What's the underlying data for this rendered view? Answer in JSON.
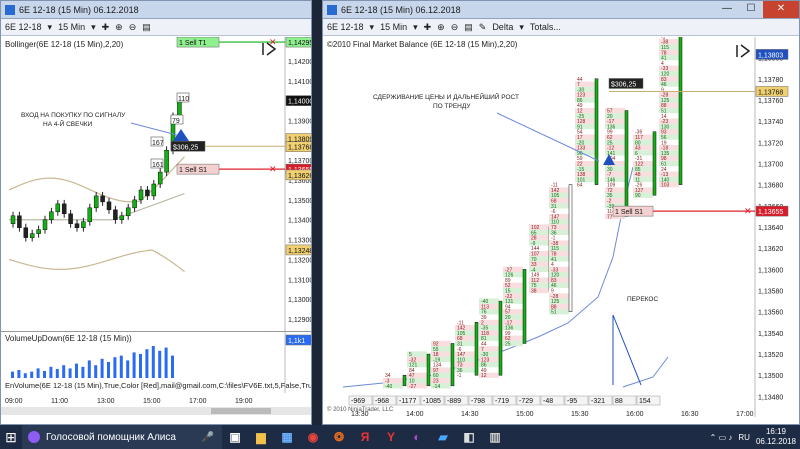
{
  "left": {
    "title": "6E 12-18 (15 Min)  06.12.2018",
    "toolbar": {
      "instrument": "6E 12-18",
      "interval": "15 Min"
    },
    "indicator": "Bollinger(6E 12-18 (15 Min),2,20)",
    "annotation": "ВХОД НА ПОКУПКУ ПО СИГНАЛУ\nНА 4-Й СВЕЧКИ",
    "orders": {
      "target": "1 Sell T1",
      "position": "$306,25",
      "stop": "1 Sell S1"
    },
    "price_levels": [
      "1,14200",
      "1,14100",
      "1,14000",
      "1,13900",
      "1,13800",
      "1,13700",
      "1,13600",
      "1,13500",
      "1,13400",
      "1,13300",
      "1,13200",
      "1,13100",
      "1,13000",
      "1,12900"
    ],
    "tags": {
      "t1": "1,14295",
      "px": "1,14000",
      "t2": "1,13809",
      "t3": "1,13768",
      "stop": "1,13655",
      "t4": "1,13626",
      "t5": "1,13248"
    },
    "volume_label": "VolumeUpDown(6E 12-18 (15 Min))",
    "volume_tag": "1,1k1",
    "volume_footer": "EnVolume(6E 12-18 (15 Min),True,Color [Red],mail@gmail.com,C:\\files\\FV6E.txt,5,False,True",
    "times": [
      "09:00",
      "11:00",
      "13:00",
      "15:00",
      "17:00",
      "19:00"
    ],
    "candle_labels": [
      "110",
      "79",
      "167",
      "161"
    ]
  },
  "right": {
    "title": "6E 12-18 (15 Min)  06.12.2018",
    "toolbar": {
      "instrument": "6E 12-18",
      "interval": "15 Min",
      "delta": "Delta",
      "totals": "Totals..."
    },
    "header": "©2010 Final Market Balance  (6E 12-18 (15 Min),2,20)",
    "annotation1": "СДЕРЖИВАНИЕ ЦЕНЫ И ДАЛЬНЕЙШИЙ РОСТ\nПО  ТРЕНДУ",
    "annotation2": "ПЕРЕКОС",
    "orders": {
      "position": "$306,25",
      "stop": "1 Sell S1"
    },
    "price_levels": [
      "1,13800",
      "1,13780",
      "1,13760",
      "1,13740",
      "1,13720",
      "1,13700",
      "1,13680",
      "1,13660",
      "1,13640",
      "1,13620",
      "1,13600",
      "1,13580",
      "1,13560",
      "1,13540",
      "1,13520",
      "1,13500",
      "1,13480"
    ],
    "tags": {
      "top": "1,13803",
      "mid": "1,13768",
      "stop": "1,13655"
    },
    "deltas": [
      "-969",
      "-968",
      "-1177",
      "-1085",
      "-889",
      "-798",
      "-719",
      "-729",
      "-48",
      "-95",
      "-321",
      "88",
      "154"
    ],
    "copyright": "© 2010 NinjaTrader, LLC",
    "times": [
      "13:30",
      "14:00",
      "14:30",
      "15:00",
      "15:30",
      "16:00",
      "16:30",
      "17:00"
    ]
  },
  "taskbar": {
    "assistant": "Голосовой помощник Алиса",
    "lang": "RU",
    "time": "16:19",
    "date": "06.12.2018"
  },
  "colors": {
    "green": "#12b012",
    "red": "#e0202a",
    "blue": "#2050c0",
    "tag_red": "#d81c2a"
  }
}
